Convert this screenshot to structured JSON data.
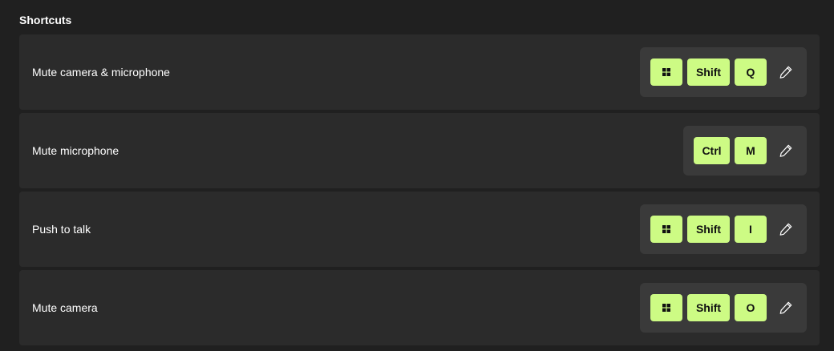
{
  "section": {
    "title": "Shortcuts"
  },
  "colors": {
    "key_bg": "#cdfb84",
    "row_bg": "#2b2b2b",
    "combo_bg": "#3a3a3a",
    "page_bg": "#202020"
  },
  "shortcuts": [
    {
      "label": "Mute camera & microphone",
      "keys": [
        "windows-icon",
        "Shift",
        "Q"
      ]
    },
    {
      "label": "Mute microphone",
      "keys": [
        "Ctrl",
        "M"
      ]
    },
    {
      "label": "Push to talk",
      "keys": [
        "windows-icon",
        "Shift",
        "I"
      ]
    },
    {
      "label": "Mute camera",
      "keys": [
        "windows-icon",
        "Shift",
        "O"
      ]
    }
  ],
  "icons": {
    "edit": "pencil-icon",
    "windows": "windows-icon"
  }
}
